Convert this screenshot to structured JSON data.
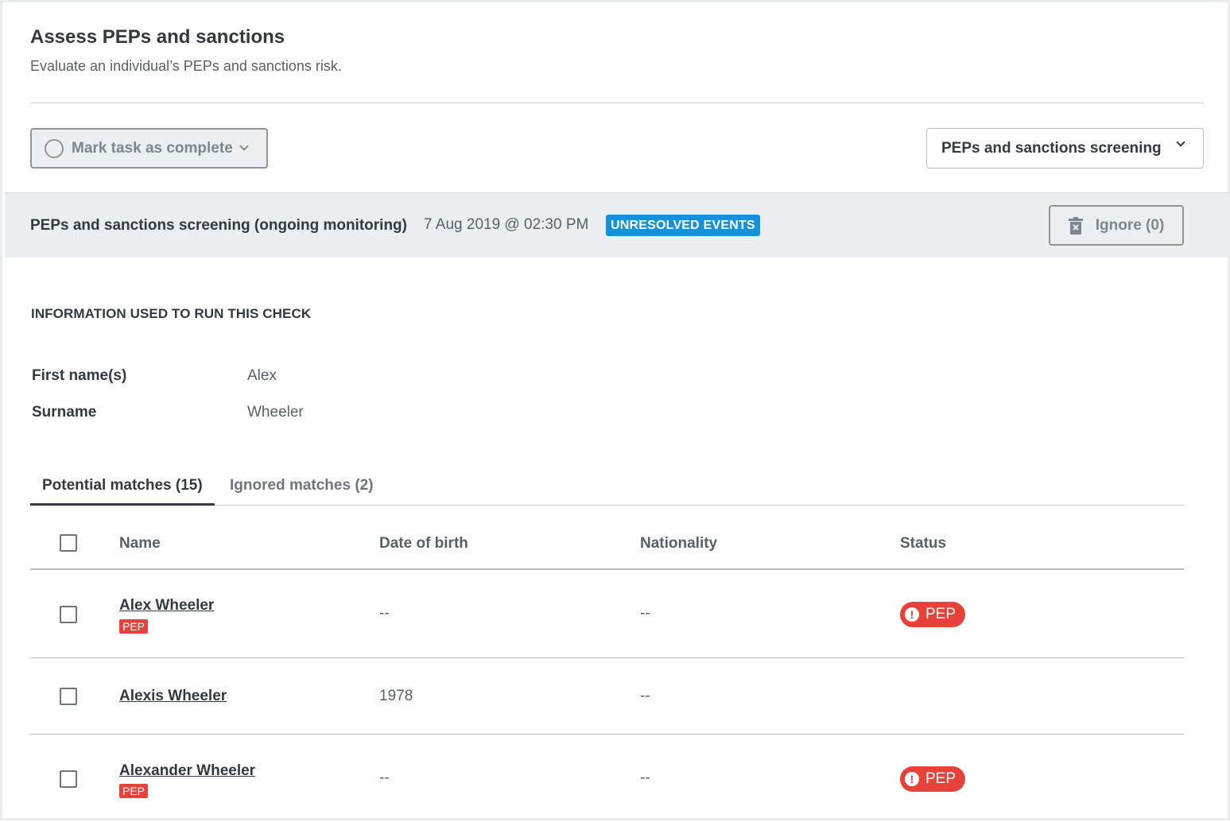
{
  "header": {
    "title": "Assess PEPs and sanctions",
    "subtitle": "Evaluate an individual’s PEPs and sanctions risk."
  },
  "toolbar": {
    "mark_complete_label": "Mark task as complete",
    "screening_select_label": "PEPs and sanctions screening"
  },
  "check": {
    "title": "PEPs and sanctions screening (ongoing monitoring)",
    "datetime": "7 Aug 2019 @ 02:30 PM",
    "badge": "UNRESOLVED EVENTS",
    "ignore_label": "Ignore (0)"
  },
  "info": {
    "heading": "INFORMATION USED TO RUN THIS CHECK",
    "fields": [
      {
        "label": "First name(s)",
        "value": "Alex"
      },
      {
        "label": "Surname",
        "value": "Wheeler"
      }
    ]
  },
  "tabs": [
    {
      "label": "Potential matches (15)",
      "active": true
    },
    {
      "label": "Ignored matches (2)",
      "active": false
    }
  ],
  "table": {
    "columns": [
      "Name",
      "Date of birth",
      "Nationality",
      "Status"
    ],
    "rows": [
      {
        "name": "Alex Wheeler",
        "tag": "PEP",
        "dob": "--",
        "nationality": "--",
        "status": "PEP"
      },
      {
        "name": "Alexis Wheeler",
        "tag": "",
        "dob": "1978",
        "nationality": "--",
        "status": ""
      },
      {
        "name": "Alexander Wheeler",
        "tag": "PEP",
        "dob": "--",
        "nationality": "--",
        "status": "PEP"
      }
    ]
  },
  "icons": {
    "complete": "circle-icon",
    "dropdown": "chevron-down-icon",
    "ignore": "trash-icon",
    "status": "alert-icon"
  },
  "colors": {
    "badge": "#1591db",
    "pep": "#e8413a",
    "band": "#eaeef0"
  }
}
